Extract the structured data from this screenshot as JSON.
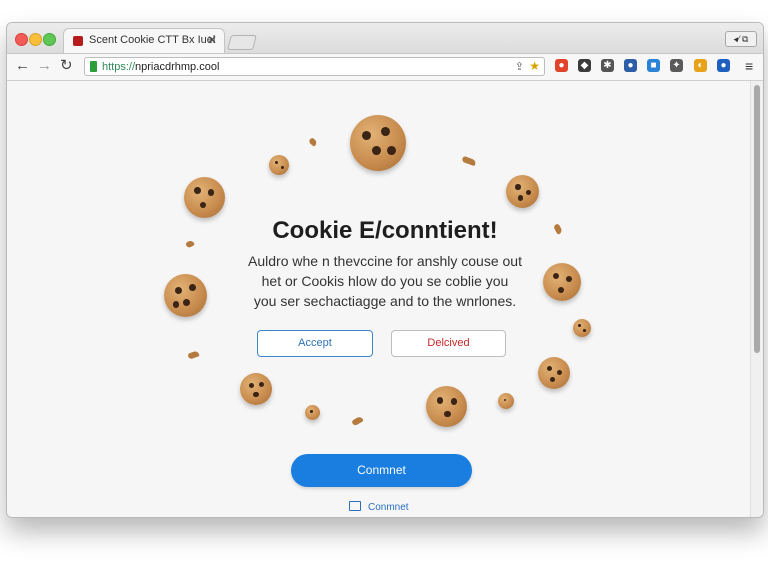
{
  "browser": {
    "tab_title": "Scent Cookie CTT Bx Iuel",
    "tab_close": "✕",
    "window_button": "◂⁄ ⧉",
    "address_url_scheme": "https://",
    "address_url_rest": "npriacdrhmp.cool",
    "back_glyph": "←",
    "forward_glyph": "→",
    "reload_glyph": "↻",
    "menu_glyph": "≡"
  },
  "extensions": [
    {
      "icon": "red-extension-icon",
      "color": "#e0452c",
      "glyph": "●"
    },
    {
      "icon": "dark-shield-extension-icon",
      "color": "#3b3b3b",
      "glyph": "◆"
    },
    {
      "icon": "pin-extension-icon",
      "color": "#555555",
      "glyph": "✱"
    },
    {
      "icon": "blue-globe-extension-icon",
      "color": "#2d5fa8",
      "glyph": "●"
    },
    {
      "icon": "translate-extension-icon",
      "color": "#2b83d6",
      "glyph": "■"
    },
    {
      "icon": "puzzle-extension-icon",
      "color": "#5a5a5a",
      "glyph": "✦"
    },
    {
      "icon": "yellow-blue-extension-icon",
      "color": "#e8a21a",
      "glyph": "◐"
    },
    {
      "icon": "blue-circle-extension-icon",
      "color": "#1f5fbf",
      "glyph": "●"
    }
  ],
  "dialog": {
    "title": "Cookie E/conntient!",
    "description_lines": [
      "Auldro whe n thevccine for anshly couse out",
      "het or Cookis hlow do you se coblie you",
      "you ser sechactiagge and to the wnrlones."
    ],
    "accept_label": "Accept",
    "declined_label": "Delcived",
    "primary_label": "Conmnet",
    "link_label": "Conmnet"
  },
  "colors": {
    "accent_blue": "#1a7de0",
    "decline_red": "#c62828",
    "cookie_brown": "#c98d4f"
  }
}
